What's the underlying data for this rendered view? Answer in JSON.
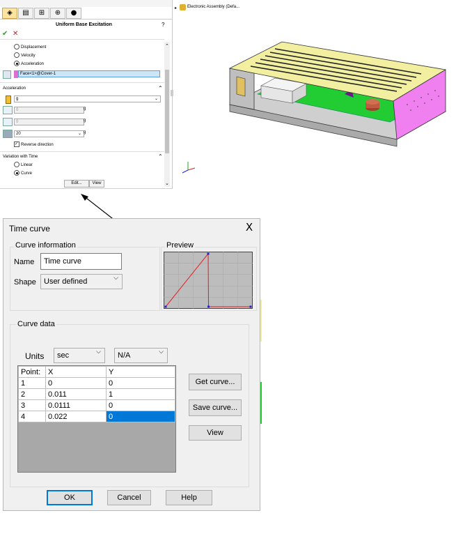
{
  "property_manager": {
    "title": "Uniform Base Excitation",
    "help": "?",
    "ok_icon": "check-icon",
    "cancel_icon": "x-icon",
    "type_options": [
      "Displacement",
      "Velocity",
      "Acceleration"
    ],
    "selected_type": "Acceleration",
    "face_selection": "Face<1>@Cover-1",
    "acceleration_header": "Acceleration",
    "unit": "g",
    "values": [
      {
        "value": "0",
        "unit": "g"
      },
      {
        "value": "0",
        "unit": "g"
      },
      {
        "value": "20",
        "unit": "g"
      }
    ],
    "reverse_direction": "Reverse direction",
    "variation_header": "Variation with Time",
    "variation_options": [
      "Linear",
      "Curve"
    ],
    "selected_variation": "Curve",
    "edit_button": "Edit...",
    "view_button": "View"
  },
  "tree": {
    "item": "Electronic Assembly (Defa..."
  },
  "dialog": {
    "title": "Time curve",
    "close": "X",
    "curve_information": "Curve information",
    "name_label": "Name",
    "name_value": "Time curve",
    "shape_label": "Shape",
    "shape_value": "User defined",
    "preview_label": "Preview",
    "curve_data": "Curve data",
    "units_label": "Units",
    "units_x": "sec",
    "units_y": "N/A",
    "table_headers": [
      "Point:",
      "X",
      "Y"
    ],
    "rows": [
      [
        "1",
        "0",
        "0"
      ],
      [
        "2",
        "0.011",
        "1"
      ],
      [
        "3",
        "0.0111",
        "0"
      ],
      [
        "4",
        "0.022",
        "0"
      ]
    ],
    "get_curve": "Get curve...",
    "save_curve": "Save curve...",
    "view": "View",
    "ok": "OK",
    "cancel": "Cancel",
    "help": "Help"
  },
  "colors": {
    "accent": "#0078d7",
    "curve_red": "#e02020",
    "board_green": "#22cc33",
    "panel_pink": "#f080f0",
    "lid_yellow": "#f2f0a0"
  }
}
